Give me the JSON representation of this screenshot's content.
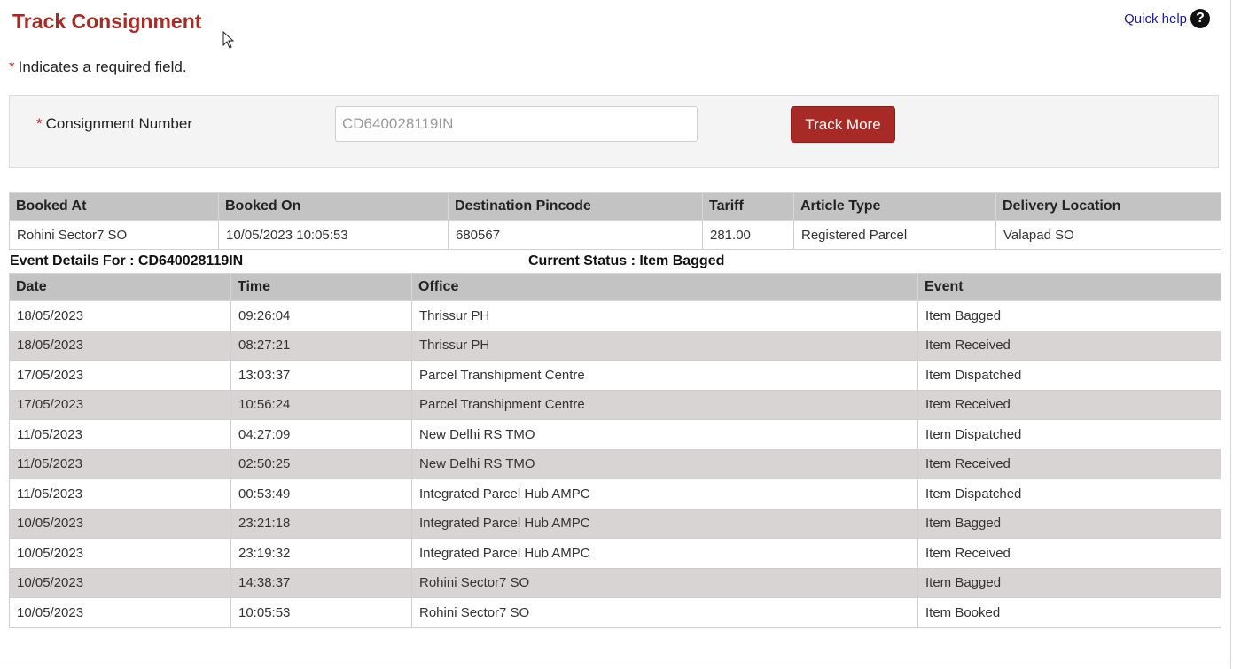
{
  "page": {
    "title": "Track Consignment"
  },
  "help": {
    "label": "Quick help",
    "icon": "question-circle-icon"
  },
  "form": {
    "required_star": "*",
    "required_note": "Indicates a required field.",
    "consignment_label": "Consignment Number",
    "consignment_value": "CD640028119IN",
    "track_button": "Track More"
  },
  "booking": {
    "headers": [
      "Booked At",
      "Booked On",
      "Destination Pincode",
      "Tariff",
      "Article Type",
      "Delivery Location"
    ],
    "row": [
      "Rohini Sector7 SO",
      "10/05/2023 10:05:53",
      "680567",
      "281.00",
      "Registered Parcel",
      "Valapad SO"
    ]
  },
  "event_details": {
    "label": "Event Details For : CD640028119IN",
    "current_status": "Current Status : Item Bagged"
  },
  "events": {
    "headers": [
      "Date",
      "Time",
      "Office",
      "Event"
    ],
    "rows": [
      [
        "18/05/2023",
        "09:26:04",
        "Thrissur PH",
        "Item Bagged"
      ],
      [
        "18/05/2023",
        "08:27:21",
        "Thrissur PH",
        "Item Received"
      ],
      [
        "17/05/2023",
        "13:03:37",
        "Parcel Transhipment Centre",
        "Item Dispatched"
      ],
      [
        "17/05/2023",
        "10:56:24",
        "Parcel Transhipment Centre",
        "Item Received"
      ],
      [
        "11/05/2023",
        "04:27:09",
        "New Delhi RS TMO",
        "Item Dispatched"
      ],
      [
        "11/05/2023",
        "02:50:25",
        "New Delhi RS TMO",
        "Item Received"
      ],
      [
        "11/05/2023",
        "00:53:49",
        "Integrated Parcel Hub AMPC",
        "Item Dispatched"
      ],
      [
        "10/05/2023",
        "23:21:18",
        "Integrated Parcel Hub AMPC",
        "Item Bagged"
      ],
      [
        "10/05/2023",
        "23:19:32",
        "Integrated Parcel Hub AMPC",
        "Item Received"
      ],
      [
        "10/05/2023",
        "14:38:37",
        "Rohini Sector7 SO",
        "Item Bagged"
      ],
      [
        "10/05/2023",
        "10:05:53",
        "Rohini Sector7 SO",
        "Item Booked"
      ]
    ]
  },
  "colors": {
    "accent": "#a72a25",
    "header_bg": "#c3c3c3",
    "alt_row": "#d8d4d4"
  }
}
